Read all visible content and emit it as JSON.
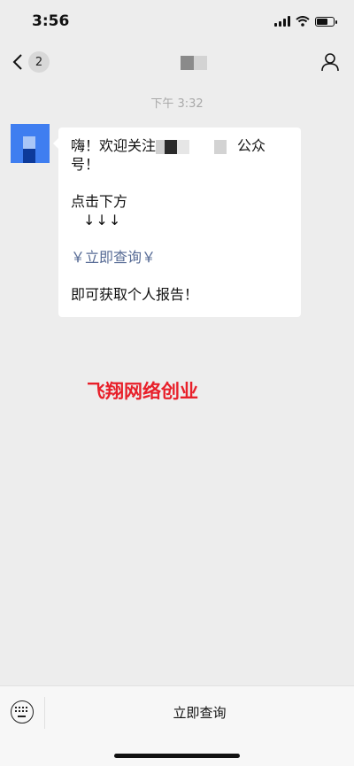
{
  "status": {
    "time": "3:56",
    "battery_level": 0.7
  },
  "nav": {
    "back_count": "2",
    "title_colors": [
      "#8a8a8a",
      "#d3d3d3"
    ]
  },
  "chat": {
    "timestamp": "下午 3:32",
    "message": {
      "line1_prefix": "嗨！欢迎关注",
      "line1_suffix": "公众",
      "line2": "号！",
      "line3": "点击下方",
      "line4": "↓↓↓",
      "link": "￥立即查询￥",
      "line5": "即可获取个人报告！"
    }
  },
  "watermark": {
    "text": "飞翔网络创业",
    "color": "#e8202a"
  },
  "bottom_bar": {
    "menu_item": "立即查询"
  },
  "colors": {
    "background": "#ededed",
    "link": "#576b95",
    "avatar": "#3f7ef0"
  }
}
